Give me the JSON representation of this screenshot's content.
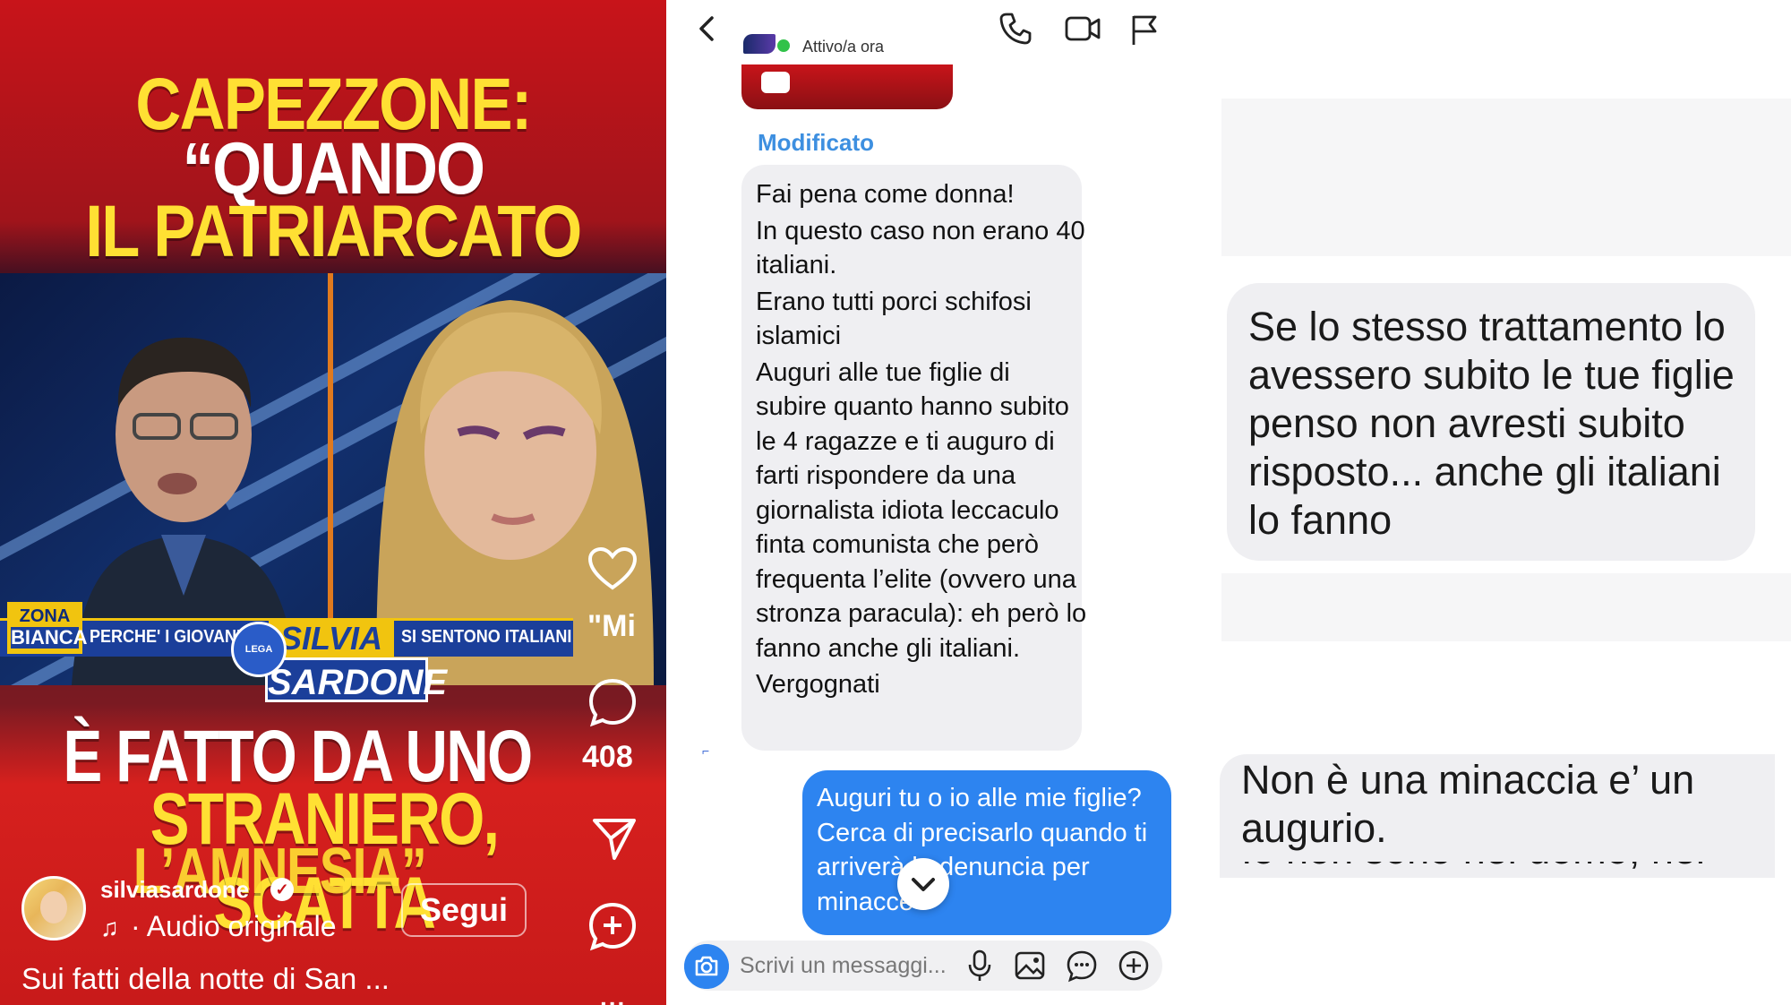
{
  "reel": {
    "headline_top": [
      "CAPEZZONE:",
      "“QUANDO",
      "IL PATRIARCATO"
    ],
    "headline_bottom": [
      "È FATTO DA UNO",
      "STRANIERO, SCATTA",
      "L’AMNESIA”"
    ],
    "ticker": {
      "badge_top": "ZONA",
      "badge_bottom": "BIANCA",
      "left": "PERCHE' I GIOVANI F",
      "right": "SI SENTONO ITALIANI"
    },
    "name_first": "SILVIA",
    "name_last": "SARDONE",
    "lega_badge": "LEGA",
    "overlay_text": "\"Mi",
    "comment_count": "408",
    "username": "silviasardone",
    "follow_label": "Segui",
    "audio_label": "· Audio originale",
    "caption": "Sui fatti della notte di San ...",
    "more": "...",
    "colors": {
      "yellow": "#ffe033",
      "red": "#c8141a",
      "blue": "#1b3f9a"
    }
  },
  "chat": {
    "status": "Attivo/a ora",
    "edited_label": "Modificato",
    "incoming_message": [
      "Fai pena come donna!",
      "In questo caso non erano 40 italiani.",
      "Erano tutti porci schifosi islamici",
      "Auguri alle tue figlie di subire quanto hanno subito le 4 ragazze e ti auguro di farti rispondere da una giornalista idiota leccaculo finta comunista che però frequenta l’elite (ovvero una stronza paracula): eh però lo fanno anche gli italiani.",
      "Vergognati"
    ],
    "outgoing_message": "Auguri tu o io alle mie figlie? Cerca di precisarlo quando ti arriverà la denuncia per minacce",
    "composer_placeholder": "Scrivi un messaggi...",
    "icons": [
      "back-icon",
      "call-icon",
      "video-icon",
      "flag-icon",
      "camera-icon",
      "mic-icon",
      "image-icon",
      "sticker-icon",
      "plus-icon"
    ],
    "colors": {
      "accent": "#2d84f0",
      "edited": "#3d8fe0",
      "bubble_in": "#efeff2",
      "online": "#31c24a"
    }
  },
  "right_panel": {
    "message_1": "Se lo stesso trattamento lo avessero subito le tue figlie penso non avresti subito risposto... anche gli italiani lo fanno",
    "message_2": "Non è una minaccia e’ un augurio.",
    "message_2_cut": "Io non sono nel uomo, nel"
  }
}
